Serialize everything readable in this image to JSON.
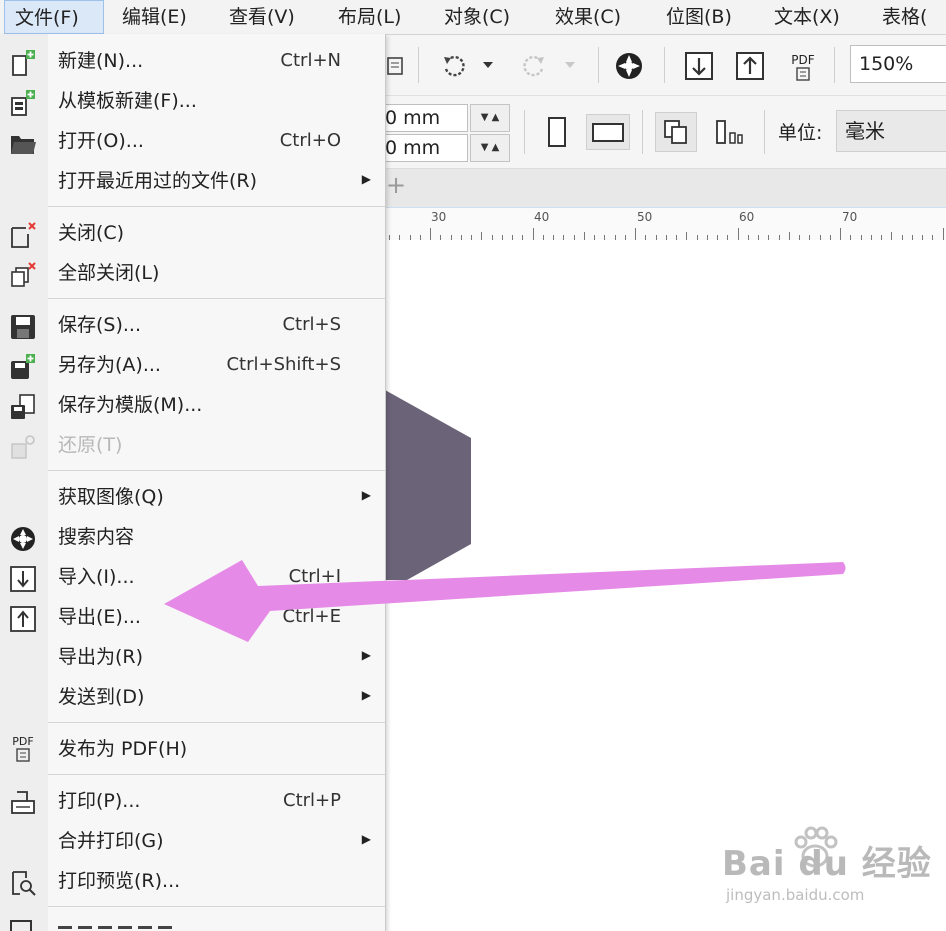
{
  "menubar": {
    "items": [
      {
        "label": "文件(F)"
      },
      {
        "label": "编辑(E)"
      },
      {
        "label": "查看(V)"
      },
      {
        "label": "布局(L)"
      },
      {
        "label": "对象(C)"
      },
      {
        "label": "效果(C)"
      },
      {
        "label": "位图(B)"
      },
      {
        "label": "文本(X)"
      },
      {
        "label": "表格("
      }
    ]
  },
  "toolbar": {
    "zoom": "150%",
    "pdf_label": "PDF",
    "width_value": "0 mm",
    "height_value": "0 mm",
    "unit_label": "单位:",
    "unit_value": "毫米"
  },
  "tabs": {
    "add_label": "+"
  },
  "ruler": {
    "labels": [
      "30",
      "40",
      "50",
      "60",
      "70"
    ]
  },
  "file_menu": {
    "items": [
      {
        "label": "新建(N)...",
        "shortcut": "Ctrl+N",
        "icon": "new-document-icon"
      },
      {
        "label": "从模板新建(F)...",
        "shortcut": "",
        "icon": "new-from-template-icon"
      },
      {
        "label": "打开(O)...",
        "shortcut": "Ctrl+O",
        "icon": "open-folder-icon"
      },
      {
        "label": "打开最近用过的文件(R)",
        "shortcut": "",
        "submenu": true
      },
      {
        "label": "关闭(C)",
        "shortcut": "",
        "icon": "close-document-icon"
      },
      {
        "label": "全部关闭(L)",
        "shortcut": "",
        "icon": "close-all-icon"
      },
      {
        "label": "保存(S)...",
        "shortcut": "Ctrl+S",
        "icon": "save-icon"
      },
      {
        "label": "另存为(A)...",
        "shortcut": "Ctrl+Shift+S",
        "icon": "save-as-icon"
      },
      {
        "label": "保存为模版(M)...",
        "shortcut": "",
        "icon": "save-template-icon"
      },
      {
        "label": "还原(T)",
        "shortcut": "",
        "icon": "revert-icon",
        "disabled": true
      },
      {
        "label": "获取图像(Q)",
        "shortcut": "",
        "submenu": true
      },
      {
        "label": "搜索内容",
        "shortcut": "",
        "icon": "search-content-icon"
      },
      {
        "label": "导入(I)...",
        "shortcut": "Ctrl+I",
        "icon": "import-icon"
      },
      {
        "label": "导出(E)...",
        "shortcut": "Ctrl+E",
        "icon": "export-icon"
      },
      {
        "label": "导出为(R)",
        "shortcut": "",
        "submenu": true
      },
      {
        "label": "发送到(D)",
        "shortcut": "",
        "submenu": true
      },
      {
        "label": "发布为 PDF(H)",
        "shortcut": "",
        "icon": "publish-pdf-icon"
      },
      {
        "label": "打印(P)...",
        "shortcut": "Ctrl+P",
        "icon": "print-icon"
      },
      {
        "label": "合并打印(G)",
        "shortcut": "",
        "submenu": true
      },
      {
        "label": "打印预览(R)...",
        "shortcut": "",
        "icon": "print-preview-icon"
      }
    ],
    "pdf_icon_text": "PDF",
    "submenu_arrow": "▶"
  },
  "watermark": {
    "main": "Bai du 经验",
    "sub": "jingyan.baidu.com"
  },
  "colors": {
    "shape_fill": "#6b6478",
    "arrow": "#e58ae6",
    "menu_bg": "#f7f7f7",
    "active_menu": "#dbe8f8"
  }
}
